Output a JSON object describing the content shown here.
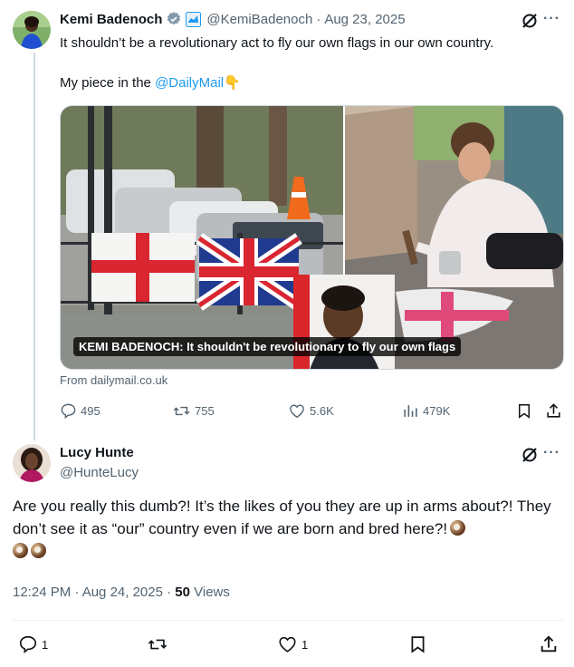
{
  "tweet": {
    "author_name": "Kemi Badenoch",
    "handle": "@KemiBadenoch",
    "date": "Aug 23, 2025",
    "text": "It shouldn’t be a revolutionary act to fly our own flags in our own country.",
    "piece_prefix": "My piece in the ",
    "piece_link": "@DailyMail",
    "piece_emoji": "👇",
    "media_caption": "KEMI BADENOCH: It shouldn't be revolutionary to fly our own flags",
    "link_source": "From dailymail.co.uk",
    "stats": {
      "replies": "495",
      "reposts": "755",
      "likes": "5.6K",
      "views": "479K"
    }
  },
  "reply": {
    "author_name": "Lucy Hunte",
    "handle": "@HunteLucy",
    "text": "Are you really this dumb?! It’s the likes of you they are up in arms about?! They don’t see it as “our” country even if we are born and bred here?!",
    "time": "12:24 PM · Aug 24, 2025 · ",
    "views_count": "50",
    "views_label": " Views",
    "stats": {
      "replies": "1",
      "likes": "1"
    }
  },
  "colors": {
    "accent": "#1d9bf0",
    "muted": "#536471",
    "verified_gray": "#829aab"
  },
  "icons": [
    "verified-badge-icon",
    "affiliate-icon",
    "grok-icon",
    "more-icon",
    "reply-icon",
    "repost-icon",
    "like-icon",
    "views-icon",
    "bookmark-icon",
    "share-icon",
    "coconut-emoji-icon"
  ]
}
